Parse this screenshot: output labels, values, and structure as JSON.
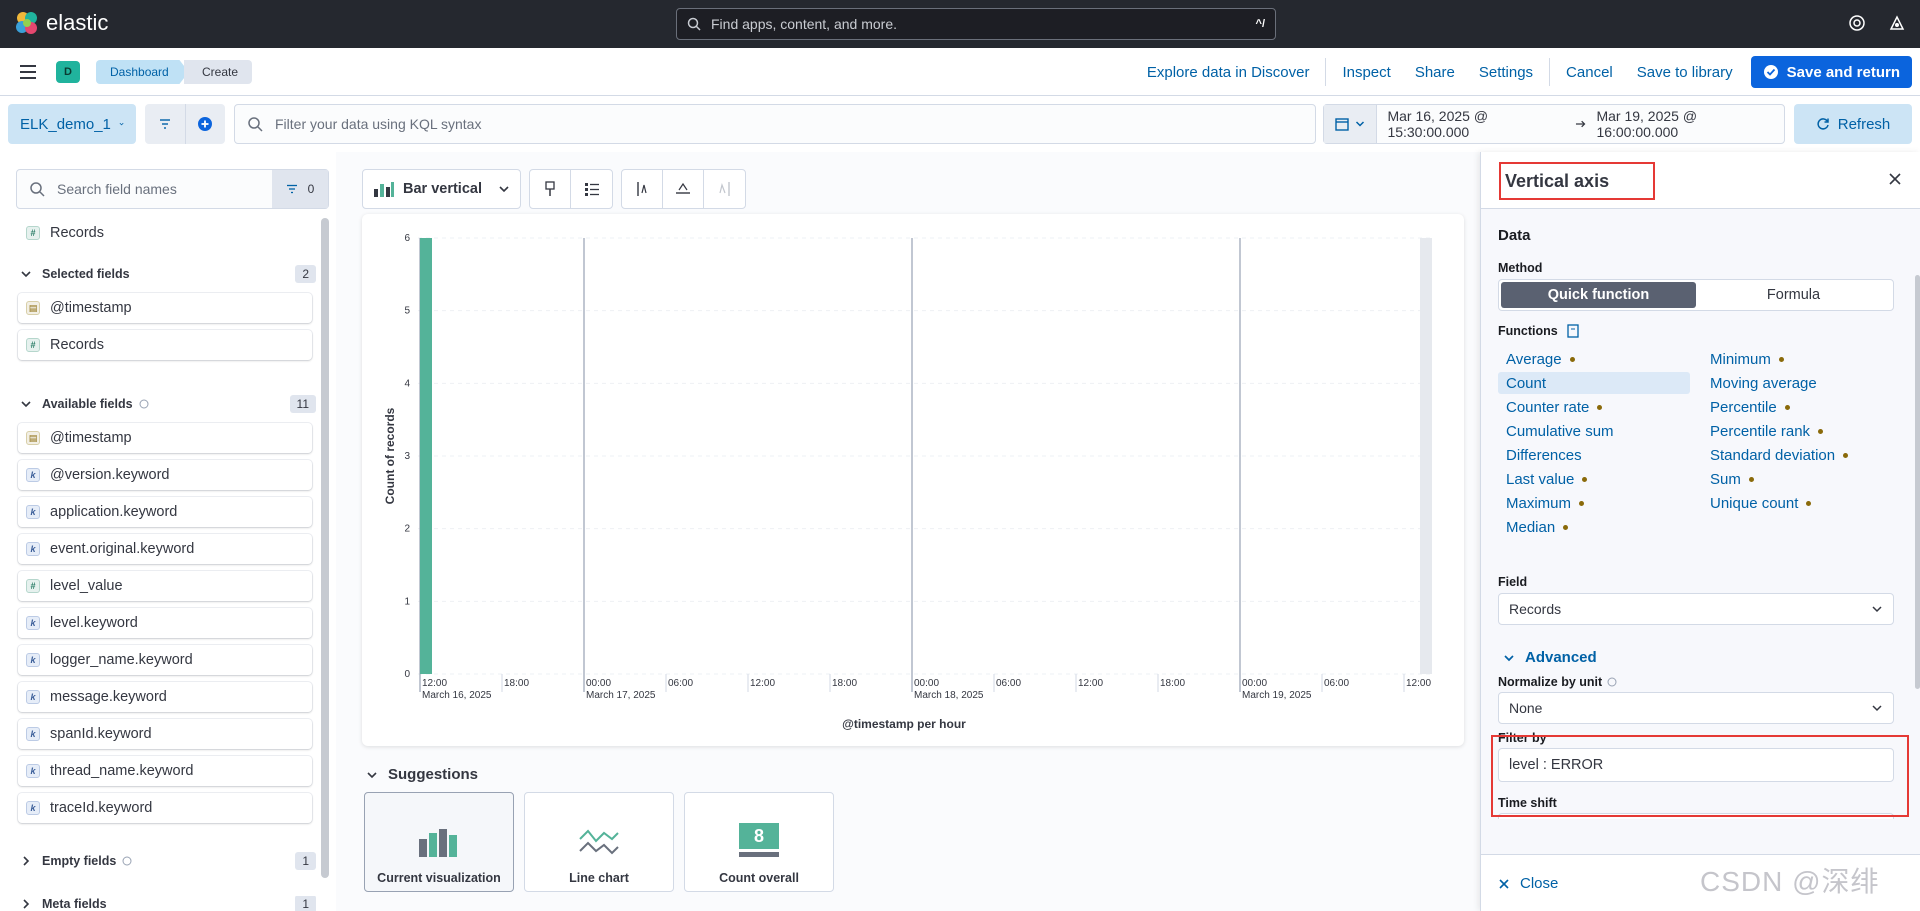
{
  "app": {
    "name": "elastic",
    "global_search_placeholder": "Find apps, content, and more.",
    "global_search_shortcut": "^/"
  },
  "header": {
    "avatar_letter": "D",
    "breadcrumbs": [
      "Dashboard",
      "Create"
    ],
    "links": [
      "Explore data in Discover",
      "Inspect",
      "Share",
      "Settings",
      "Cancel",
      "Save to library"
    ],
    "primary_button": "Save and return"
  },
  "querybar": {
    "data_view": "ELK_demo_1",
    "kql_placeholder": "Filter your data using KQL syntax",
    "start_date": "Mar 16, 2025 @ 15:30:00.000",
    "end_date": "Mar 19, 2025 @ 16:00:00.000",
    "refresh_label": "Refresh"
  },
  "fields_panel": {
    "search_placeholder": "Search field names",
    "filter_count": "0",
    "top_field": "Records",
    "selected_label": "Selected fields",
    "selected_count": "2",
    "selected": [
      {
        "name": "@timestamp",
        "type": "date"
      },
      {
        "name": "Records",
        "type": "number"
      }
    ],
    "available_label": "Available fields",
    "available_count": "11",
    "available": [
      {
        "name": "@timestamp",
        "type": "date"
      },
      {
        "name": "@version.keyword",
        "type": "keyword"
      },
      {
        "name": "application.keyword",
        "type": "keyword"
      },
      {
        "name": "event.original.keyword",
        "type": "keyword"
      },
      {
        "name": "level_value",
        "type": "number"
      },
      {
        "name": "level.keyword",
        "type": "keyword"
      },
      {
        "name": "logger_name.keyword",
        "type": "keyword"
      },
      {
        "name": "message.keyword",
        "type": "keyword"
      },
      {
        "name": "spanId.keyword",
        "type": "keyword"
      },
      {
        "name": "thread_name.keyword",
        "type": "keyword"
      },
      {
        "name": "traceId.keyword",
        "type": "keyword"
      }
    ],
    "empty_label": "Empty fields",
    "empty_count": "1",
    "meta_label": "Meta fields",
    "meta_count": "1"
  },
  "workspace": {
    "chart_type_label": "Bar vertical",
    "suggestions_label": "Suggestions",
    "suggestions": [
      "Current visualization",
      "Line chart",
      "Count overall"
    ],
    "count_overall_value": "8"
  },
  "chart_data": {
    "type": "bar",
    "ylabel": "Count of records",
    "xlabel": "@timestamp per hour",
    "ylim": [
      0,
      6
    ],
    "yticks": [
      "0",
      "1",
      "2",
      "3",
      "4",
      "5",
      "6"
    ],
    "xticks": [
      {
        "label": "12:00",
        "sub": "March 16, 2025"
      },
      {
        "label": "18:00",
        "sub": ""
      },
      {
        "label": "00:00",
        "sub": "March 17, 2025"
      },
      {
        "label": "06:00",
        "sub": ""
      },
      {
        "label": "12:00",
        "sub": ""
      },
      {
        "label": "18:00",
        "sub": ""
      },
      {
        "label": "00:00",
        "sub": "March 18, 2025"
      },
      {
        "label": "06:00",
        "sub": ""
      },
      {
        "label": "12:00",
        "sub": ""
      },
      {
        "label": "18:00",
        "sub": ""
      },
      {
        "label": "00:00",
        "sub": "March 19, 2025"
      },
      {
        "label": "06:00",
        "sub": ""
      },
      {
        "label": "12:00",
        "sub": ""
      }
    ],
    "bars": [
      {
        "x": "March 16, 2025 15:00",
        "value": 6
      }
    ],
    "bar_color": "#54b399",
    "grid": true
  },
  "flyout": {
    "title": "Vertical axis",
    "data_label": "Data",
    "method_label": "Method",
    "method_options": [
      "Quick function",
      "Formula"
    ],
    "functions_label": "Functions",
    "functions_left": [
      {
        "name": "Average",
        "dot": true
      },
      {
        "name": "Count",
        "dot": false,
        "selected": true
      },
      {
        "name": "Counter rate",
        "dot": true
      },
      {
        "name": "Cumulative sum",
        "dot": false
      },
      {
        "name": "Differences",
        "dot": false
      },
      {
        "name": "Last value",
        "dot": true
      },
      {
        "name": "Maximum",
        "dot": true
      },
      {
        "name": "Median",
        "dot": true
      }
    ],
    "functions_right": [
      {
        "name": "Minimum",
        "dot": true
      },
      {
        "name": "Moving average",
        "dot": false
      },
      {
        "name": "Percentile",
        "dot": true
      },
      {
        "name": "Percentile rank",
        "dot": true
      },
      {
        "name": "Standard deviation",
        "dot": true
      },
      {
        "name": "Sum",
        "dot": true
      },
      {
        "name": "Unique count",
        "dot": true
      }
    ],
    "field_label": "Field",
    "field_value": "Records",
    "advanced_label": "Advanced",
    "normalize_label": "Normalize by unit",
    "normalize_value": "None",
    "filter_label": "Filter by",
    "filter_value": "level : ERROR",
    "timeshift_label": "Time shift",
    "close_label": "Close"
  },
  "watermark": "CSDN @深绯"
}
